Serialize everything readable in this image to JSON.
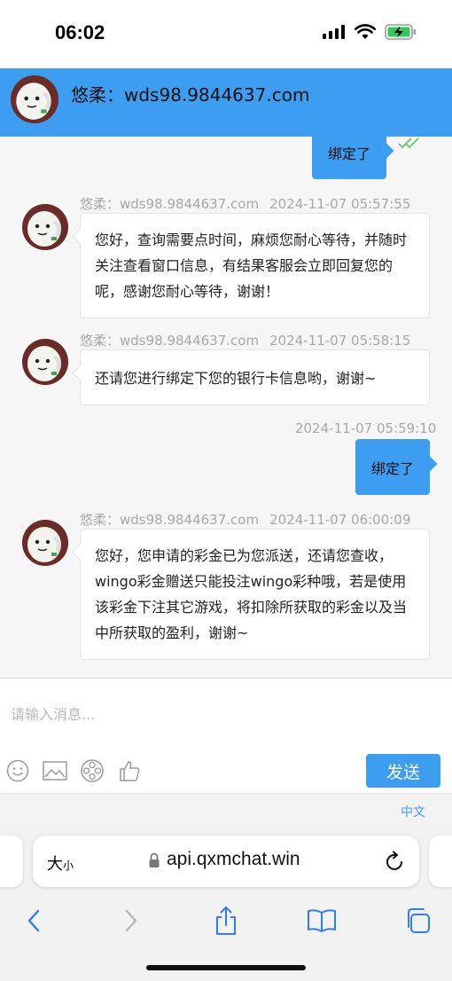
{
  "status_bar": {
    "time": "06:02"
  },
  "header": {
    "title": "悠柔：wds98.9844637.com"
  },
  "messages": [
    {
      "type": "out",
      "text": "绑定了",
      "read_icon": "double-check-icon"
    },
    {
      "type": "in",
      "sender": "悠柔：wds98.9844637.com",
      "time": "2024-11-07 05:57:55",
      "text": "您好，查询需要点时间，麻烦您耐心等待，并随时关注查看窗口信息，有结果客服会立即回复您的呢，感谢您耐心等待，谢谢！"
    },
    {
      "type": "in",
      "sender": "悠柔：wds98.9844637.com",
      "time": "2024-11-07 05:58:15",
      "text": "还请您进行绑定下您的银行卡信息哟，谢谢~"
    },
    {
      "type": "out",
      "time": "2024-11-07 05:59:10",
      "text": "绑定了"
    },
    {
      "type": "in",
      "sender": "悠柔：wds98.9844637.com",
      "time": "2024-11-07 06:00:09",
      "text": "您好，您申请的彩金已为您派送，还请您查收，wingo彩金赠送只能投注wingo彩种哦，若是使用该彩金下注其它游戏，将扣除所获取的彩金以及当中所获取的盈利，谢谢~"
    }
  ],
  "input": {
    "placeholder": "请输入消息..."
  },
  "toolbar": {
    "icons": [
      "emoji-icon",
      "image-icon",
      "film-reel-icon",
      "thumbs-up-icon"
    ],
    "send_label": "发送"
  },
  "language": {
    "label": "中文"
  },
  "browser": {
    "text_size_big": "大",
    "text_size_small": "小",
    "url": "api.qxmchat.win"
  },
  "colors": {
    "accent": "#3d9df0",
    "incoming_bubble": "#ffffff",
    "background": "#f6f6f6"
  }
}
